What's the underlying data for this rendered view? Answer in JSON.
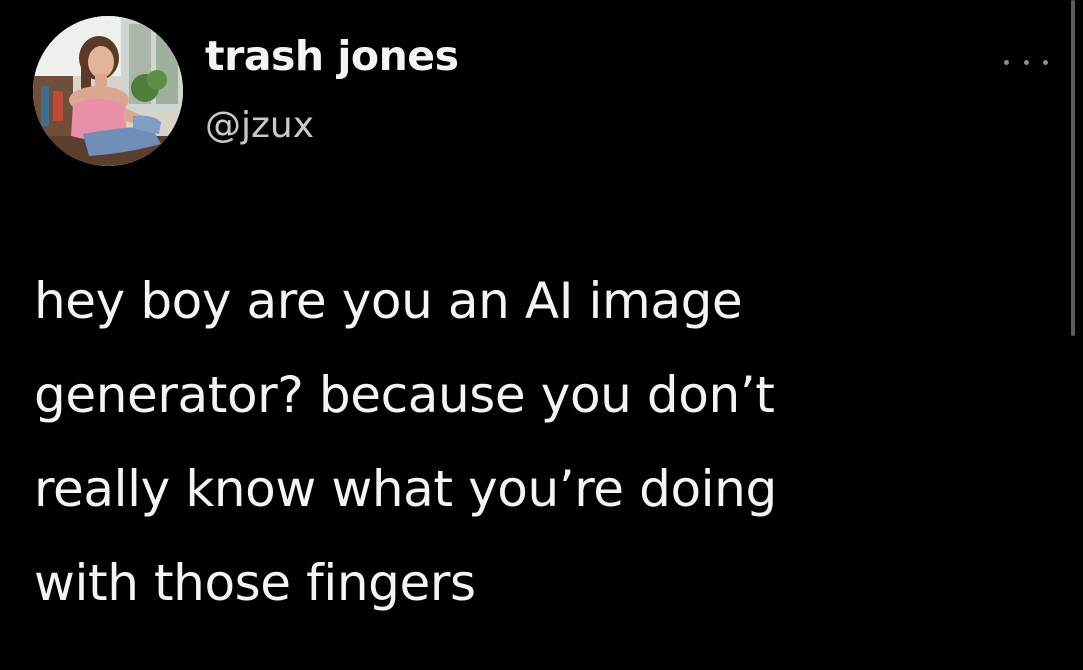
{
  "author": {
    "display_name": "trash jones",
    "handle": "@jzux",
    "avatar_icon": "profile-photo"
  },
  "tweet": {
    "lines": [
      "hey boy are you an AI image",
      "generator? because you don’t",
      "really know what you’re doing",
      "with those fingers"
    ]
  },
  "controls": {
    "more_icon": "more-horizontal-icon"
  },
  "colors": {
    "background": "#000000",
    "text": "#f4f4f4",
    "secondary_text": "#c9c9c9",
    "icon": "#8d8d8d"
  }
}
